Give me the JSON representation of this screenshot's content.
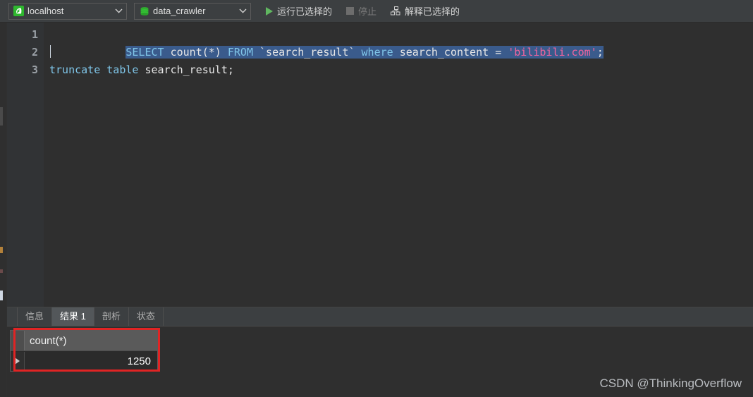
{
  "toolbar": {
    "connection": {
      "icon": "navicat-connection-icon",
      "value": "localhost",
      "chevron": "chevron-down-icon"
    },
    "database": {
      "icon": "database-icon",
      "value": "data_crawler",
      "chevron": "chevron-down-icon"
    },
    "run_selected": {
      "icon": "play-icon",
      "label": "运行已选择的",
      "enabled": true
    },
    "stop": {
      "icon": "stop-icon",
      "label": "停止",
      "enabled": false
    },
    "explain_selected": {
      "icon": "explain-plan-icon",
      "label": "解释已选择的",
      "enabled": true
    }
  },
  "editor": {
    "line_numbers": [
      "1",
      "2",
      "3"
    ],
    "lines": [
      {
        "number": "1",
        "selected": true,
        "tokens": [
          {
            "text": "SELECT",
            "type": "keyword"
          },
          {
            "text": " ",
            "type": "plain"
          },
          {
            "text": "count",
            "type": "plain"
          },
          {
            "text": "(*)",
            "type": "plain"
          },
          {
            "text": " ",
            "type": "plain"
          },
          {
            "text": "FROM",
            "type": "keyword"
          },
          {
            "text": " `search_result`",
            "type": "plain"
          },
          {
            "text": " ",
            "type": "plain"
          },
          {
            "text": "where",
            "type": "keyword"
          },
          {
            "text": " search_content ",
            "type": "plain"
          },
          {
            "text": "=",
            "type": "plain"
          },
          {
            "text": " ",
            "type": "plain"
          },
          {
            "text": "'bilibili.com'",
            "type": "string"
          },
          {
            "text": ";",
            "type": "plain"
          }
        ],
        "plain": "SELECT count(*) FROM `search_result` where search_content = 'bilibili.com';"
      },
      {
        "number": "2",
        "selected": false,
        "tokens": [],
        "plain": ""
      },
      {
        "number": "3",
        "selected": false,
        "tokens": [
          {
            "text": "truncate",
            "type": "keyword"
          },
          {
            "text": " ",
            "type": "plain"
          },
          {
            "text": "table",
            "type": "keyword"
          },
          {
            "text": " search_result;",
            "type": "plain"
          }
        ],
        "plain": "truncate table search_result;"
      }
    ]
  },
  "bottom_tabs": [
    {
      "label": "信息",
      "active": false
    },
    {
      "label": "结果 1",
      "active": true
    },
    {
      "label": "剖析",
      "active": false
    },
    {
      "label": "状态",
      "active": false
    }
  ],
  "result_grid": {
    "columns": [
      "count(*)"
    ],
    "rows": [
      {
        "marker": "current-row-arrow-icon",
        "values": [
          "1250"
        ]
      }
    ]
  },
  "highlight": {
    "color": "#e02424"
  },
  "watermark": {
    "text": "CSDN @ThinkingOverflow"
  }
}
